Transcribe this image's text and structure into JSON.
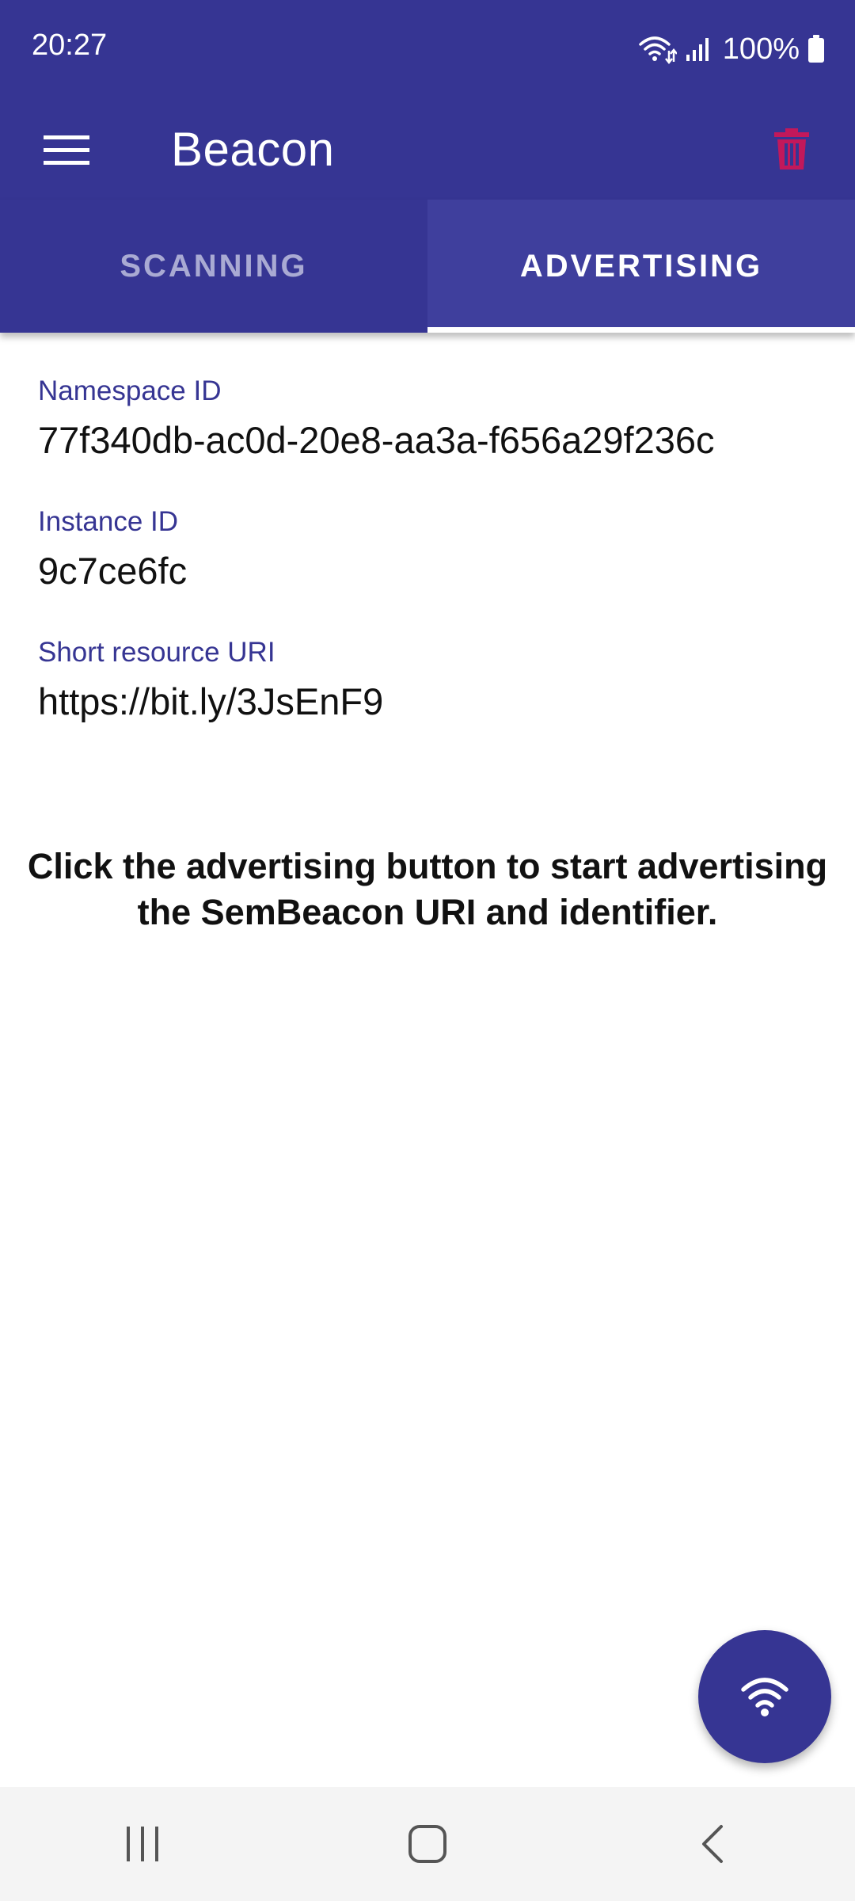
{
  "status_bar": {
    "time": "20:27",
    "battery": "100%",
    "icons": [
      "wifi-data-icon",
      "signal-icon",
      "battery-icon"
    ]
  },
  "app_bar": {
    "title": "Beacon",
    "menu_icon": "menu-icon",
    "delete_icon": "trash-icon",
    "delete_color": "#c2185b"
  },
  "tabs": [
    {
      "label": "SCANNING",
      "active": false
    },
    {
      "label": "ADVERTISING",
      "active": true
    }
  ],
  "fields": [
    {
      "label": "Namespace ID",
      "value": "77f340db-ac0d-20e8-aa3a-f656a29f236c"
    },
    {
      "label": "Instance ID",
      "value": "9c7ce6fc"
    },
    {
      "label": "Short resource URI",
      "value": "https://bit.ly/3JsEnF9"
    }
  ],
  "message": "Click the advertising button to start advertising the SemBeacon URI and identifier.",
  "fab": {
    "icon": "wifi-broadcast-icon"
  },
  "colors": {
    "primary": "#363593",
    "tab_active_bg": "#3f3f9d",
    "label": "#363593"
  },
  "nav_bar": {
    "icons": [
      "recents-icon",
      "home-icon",
      "back-icon"
    ]
  }
}
